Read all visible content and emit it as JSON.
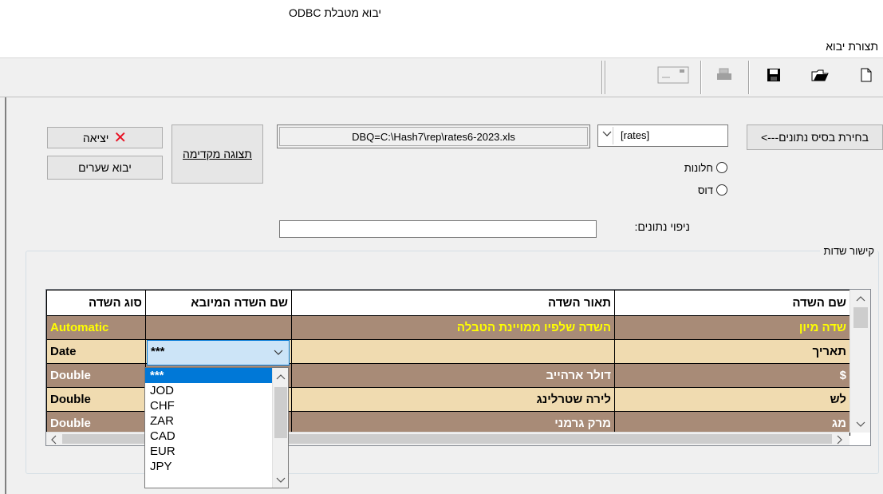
{
  "window": {
    "title": "יבוא מטבלת ODBC"
  },
  "menu": {
    "items": [
      "תצורת יבוא"
    ]
  },
  "toolbar": {
    "buttons": [
      "new-document-icon",
      "open-folder-icon",
      "save-disk-icon",
      "print-icon",
      "window-icon"
    ]
  },
  "actions": {
    "select_db_label": "בחירת בסיס נתונים--->",
    "table_select_value": "[rates]",
    "connection_string": "DBQ=C:\\Hash7\\rep\\rates6-2023.xls",
    "preview_label": "תצוגה מקדימה",
    "exit_label": "יציאה",
    "import_rates_label": "יבוא שערים"
  },
  "radios": [
    {
      "label": "חלונות",
      "checked": false
    },
    {
      "label": "דוס",
      "checked": false
    }
  ],
  "filter": {
    "label": "ניפוי נתונים:",
    "value": ""
  },
  "fields_group": {
    "title": "קישור שדות",
    "columns": [
      "שם השדה",
      "תאור השדה",
      "שם השדה המיובא",
      "סוג השדה"
    ],
    "rows": [
      {
        "name": "שדה מיון",
        "desc": "השדה שלפיו ממויינת הטבלה",
        "imported": "",
        "type": "Automatic"
      },
      {
        "name": "תאריך",
        "desc": "",
        "imported": "***",
        "type": "Date"
      },
      {
        "name": "$",
        "desc": "דולר ארהייב",
        "imported": "",
        "type": "Double"
      },
      {
        "name": "לש",
        "desc": "לירה שטרלינג",
        "imported": "",
        "type": "Double"
      },
      {
        "name": "מג",
        "desc": "מרק גרמני",
        "imported": "",
        "type": "Double"
      }
    ]
  },
  "dropdown": {
    "options": [
      "***",
      "JOD",
      "CHF",
      "ZAR",
      "CAD",
      "EUR",
      "JPY"
    ],
    "selected_index": 0
  }
}
